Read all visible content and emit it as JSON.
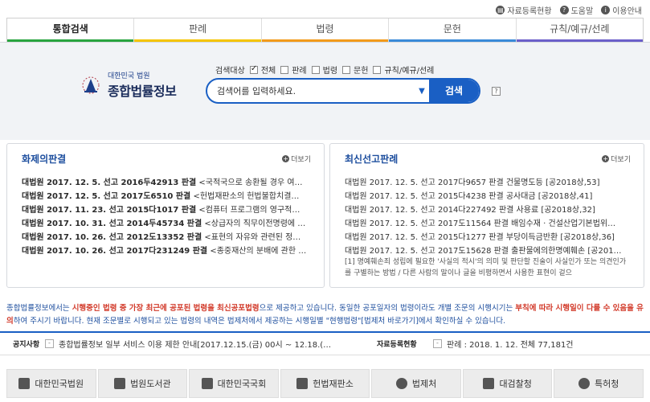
{
  "util": {
    "status": "자료등록현황",
    "help": "도움말",
    "guide": "이용안내"
  },
  "tabs": [
    "통합검색",
    "판례",
    "법령",
    "문헌",
    "규칙/예규/선례"
  ],
  "logo": {
    "line1": "대한민국 법원",
    "line2": "종합법률정보"
  },
  "scope": {
    "label": "검색대상",
    "items": [
      "전체",
      "판례",
      "법령",
      "문헌",
      "규칙/예규/선례"
    ]
  },
  "search": {
    "placeholder": "검색어를 입력하세요.",
    "button": "검색",
    "help": "?"
  },
  "left_panel": {
    "title": "화제의판결",
    "more": "더보기",
    "items": [
      {
        "case": "대법원 2017. 12. 5. 선고 2016두42913 판결",
        "desc": "<국적국으로 송환될 경우 여…"
      },
      {
        "case": "대법원 2017. 12. 5. 선고 2017도6510 판결",
        "desc": "<헌법재판소의 헌법불합치결…"
      },
      {
        "case": "대법원 2017. 11. 23. 선고 2015다1017 판결",
        "desc": "<컴퓨터 프로그램의 영구적…"
      },
      {
        "case": "대법원 2017. 10. 31. 선고 2014두45734 판결",
        "desc": "<상급자의 직무이전명령에 …"
      },
      {
        "case": "대법원 2017. 10. 26. 선고 2012도13352 판결",
        "desc": "<표현의 자유와 관련된 정…"
      },
      {
        "case": "대법원 2017. 10. 26. 선고 2017다231249 판결",
        "desc": "<종중재산의 분배에 관한 …"
      }
    ]
  },
  "right_panel": {
    "title": "최신선고판례",
    "more": "더보기",
    "items": [
      "대법원 2017. 12. 5. 선고 2017다9657 판결 건물명도등 [공2018상,53]",
      "대법원 2017. 12. 5. 선고 2015다4238 판결 공사대금 [공2018상,41]",
      "대법원 2017. 12. 5. 선고 2014다227492 판결 사용료 [공2018상,32]",
      "대법원 2017. 12. 5. 선고 2017도11564 판결 배임수재 · 건설산업기본법위…",
      "대법원 2017. 12. 5. 선고 2015다1277 판결 부당이득금반환 [공2018상,36]",
      "대법원 2017. 12. 5. 선고 2017도15628 판결 출판물에의한명예훼손 [공201…"
    ],
    "summary": "[1] 명예훼손죄 성립에 필요한 '사실의 적시'의 의미 및 판단할 진술이 사실인가 또는 의견인가를 구별하는 방법 / 다른 사람의 말이나 글을 비평하면서 사용한 표현이 겉으"
  },
  "notice": {
    "p1": "종합법률정보에서는 ",
    "r1": "시행중인 법령 중 가장 최근에 공포된 법령을 최신공포법령",
    "p2": "으로 제공하고 있습니다. 동일한 공포일자의 법령이라도 개별 조문의 시행시기는 ",
    "r2": "부칙에 따라 시행일이 다를 수 있음을 유의",
    "p3": "하여 주시기 바랍니다. 현재 조문별로 시행되고 있는 법령의 내역은 법제처에서 제공하는 시행일별 \"현행법령\"[법제처 바로가기]에서 확인하실 수 있습니다."
  },
  "bar": {
    "notice_label": "공지사항",
    "notice_text": "종합법률정보 일부 서비스 이용 제한 안내[2017.12.15.(금) 00시 ~ 12.18.(…",
    "status_label": "자료등록현황",
    "status_text": "판례 : 2018. 1. 12. 전체 77,181건"
  },
  "links": [
    "대한민국법원",
    "법원도서관",
    "대한민국국회",
    "헌법재판소",
    "법제처",
    "대검찰청",
    "특허청"
  ]
}
